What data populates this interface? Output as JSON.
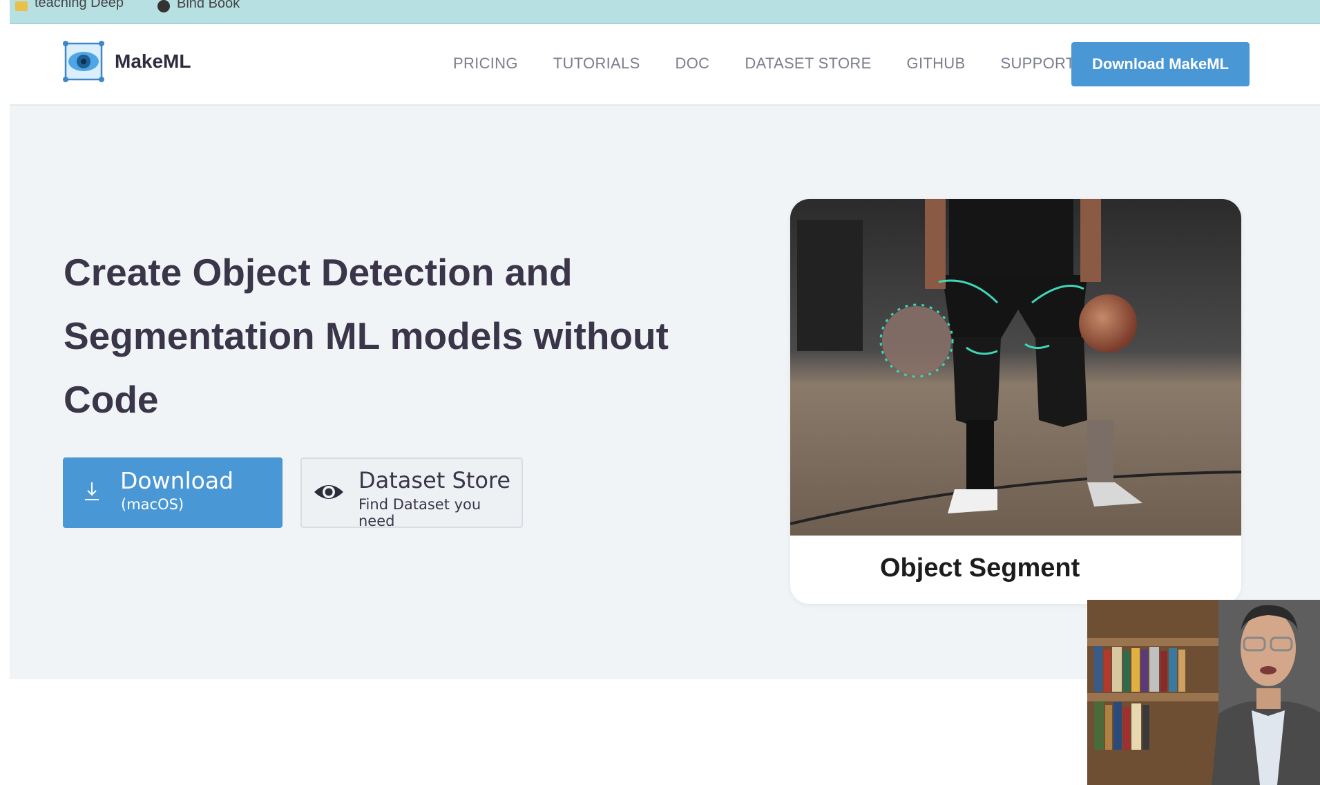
{
  "bookmarks": [
    {
      "label": "teaching Deep",
      "icon": "folder-icon"
    },
    {
      "label": "Bind Book",
      "icon": "globe-icon"
    }
  ],
  "brand": {
    "name": "MakeML",
    "icon": "eye-logo-icon"
  },
  "nav": {
    "links": [
      "PRICING",
      "TUTORIALS",
      "DOC",
      "DATASET STORE",
      "GITHUB",
      "SUPPORT"
    ],
    "cta": "Download MakeML"
  },
  "hero": {
    "headline_lines": [
      "Create Object Detection and",
      "Segmentation ML models without",
      "Code"
    ],
    "download": {
      "label": "Download",
      "sublabel": "(macOS)",
      "icon": "download-icon"
    },
    "dataset_store": {
      "label": "Dataset Store",
      "sublabel": "Find Dataset you need",
      "icon": "eye-icon"
    },
    "card": {
      "caption": "Object Segment"
    }
  },
  "colors": {
    "accent": "#4a97d6",
    "headline": "#3a3549",
    "page_bg": "#f0f4f7",
    "bookmark_bar": "#b7e0e2"
  }
}
